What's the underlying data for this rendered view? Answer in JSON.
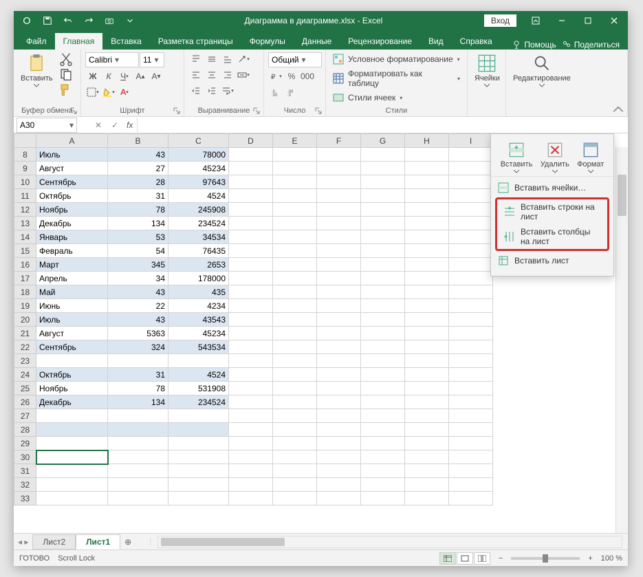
{
  "title": "Диаграмма в диаграмме.xlsx - Excel",
  "login": "Вход",
  "tabs": [
    "Файл",
    "Главная",
    "Вставка",
    "Разметка страницы",
    "Формулы",
    "Данные",
    "Рецензирование",
    "Вид",
    "Справка"
  ],
  "active_tab": 1,
  "help": {
    "tell_me": "Помощь",
    "share": "Поделиться"
  },
  "ribbon": {
    "clipboard": {
      "paste": "Вставить",
      "label": "Буфер обмена"
    },
    "font": {
      "name": "Calibri",
      "size": "11",
      "label": "Шрифт"
    },
    "alignment": {
      "label": "Выравнивание"
    },
    "number": {
      "format": "Общий",
      "label": "Число"
    },
    "styles": {
      "cond": "Условное форматирование",
      "table": "Форматировать как таблицу",
      "cell": "Стили ячеек",
      "label": "Стили"
    },
    "cells": {
      "label": "Ячейки"
    },
    "editing": {
      "label": "Редактирование"
    }
  },
  "cells_panel": {
    "insert": "Вставить",
    "delete": "Удалить",
    "format": "Формат",
    "menu": {
      "cells": "Вставить ячейки…",
      "rows": "Вставить строки на лист",
      "cols": "Вставить столбцы на лист",
      "sheet": "Вставить лист"
    }
  },
  "name_box": "A30",
  "columns": [
    "A",
    "B",
    "C",
    "D",
    "E",
    "F",
    "G",
    "H",
    "I"
  ],
  "first_row": 8,
  "visible_rows": 26,
  "selected_row": 30,
  "data": [
    {
      "r": 8,
      "a": "Июль",
      "b": 43,
      "c": 78000
    },
    {
      "r": 9,
      "a": "Август",
      "b": 27,
      "c": 45234
    },
    {
      "r": 10,
      "a": "Сентябрь",
      "b": 28,
      "c": 97643
    },
    {
      "r": 11,
      "a": "Октябрь",
      "b": 31,
      "c": 4524
    },
    {
      "r": 12,
      "a": "Ноябрь",
      "b": 78,
      "c": 245908
    },
    {
      "r": 13,
      "a": "Декабрь",
      "b": 134,
      "c": 234524
    },
    {
      "r": 14,
      "a": "Январь",
      "b": 53,
      "c": 34534
    },
    {
      "r": 15,
      "a": "Февраль",
      "b": 54,
      "c": 76435
    },
    {
      "r": 16,
      "a": "Март",
      "b": 345,
      "c": 2653
    },
    {
      "r": 17,
      "a": "Апрель",
      "b": 34,
      "c": 178000
    },
    {
      "r": 18,
      "a": "Май",
      "b": 43,
      "c": 435
    },
    {
      "r": 19,
      "a": "Июнь",
      "b": 22,
      "c": 4234
    },
    {
      "r": 20,
      "a": "Июль",
      "b": 43,
      "c": 43543
    },
    {
      "r": 21,
      "a": "Август",
      "b": 5363,
      "c": 45234
    },
    {
      "r": 22,
      "a": "Сентябрь",
      "b": 324,
      "c": 543534
    },
    {
      "r": 23,
      "a": "",
      "b": "",
      "c": ""
    },
    {
      "r": 24,
      "a": "Октябрь",
      "b": 31,
      "c": 4524
    },
    {
      "r": 25,
      "a": "Ноябрь",
      "b": 78,
      "c": 531908
    },
    {
      "r": 26,
      "a": "Декабрь",
      "b": 134,
      "c": 234524
    }
  ],
  "sheets": {
    "tabs": [
      "Лист2",
      "Лист1"
    ],
    "active": 1
  },
  "status": {
    "ready": "ГОТОВО",
    "scroll": "Scroll Lock",
    "zoom": "100 %"
  }
}
